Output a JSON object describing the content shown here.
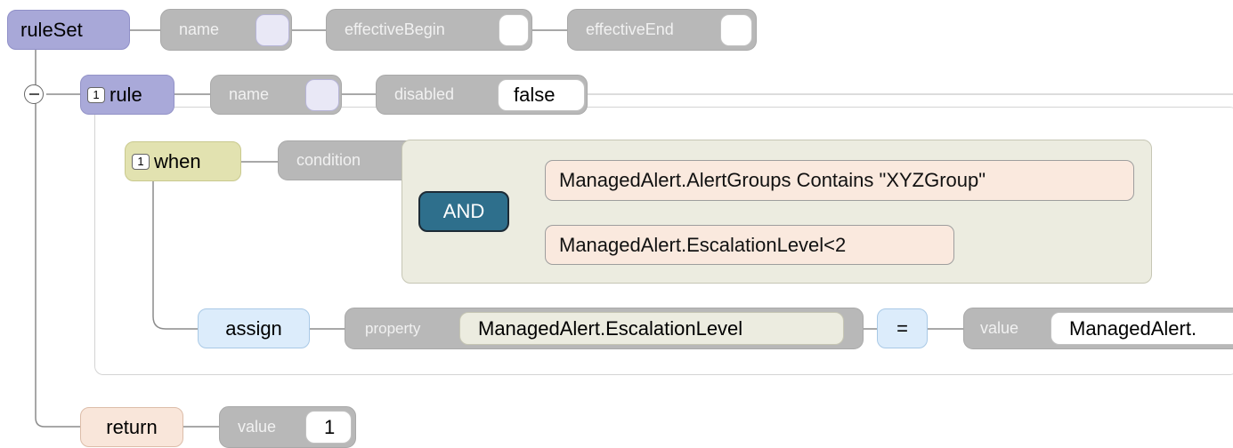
{
  "ruleset": {
    "label": "ruleSet",
    "attributes": [
      {
        "label": "name",
        "value": ""
      },
      {
        "label": "effectiveBegin",
        "value": ""
      },
      {
        "label": "effectiveEnd",
        "value": ""
      }
    ]
  },
  "rule": {
    "badge": "1",
    "label": "rule",
    "attributes": [
      {
        "label": "name",
        "value": ""
      },
      {
        "label": "disabled",
        "value": "false"
      }
    ]
  },
  "when": {
    "badge": "1",
    "label": "when",
    "condition_label": "condition",
    "operator": "AND",
    "expressions": [
      "ManagedAlert.AlertGroups Contains \"XYZGroup\"",
      "ManagedAlert.EscalationLevel<2"
    ]
  },
  "assign": {
    "label": "assign",
    "property_label": "property",
    "property_value": "ManagedAlert.EscalationLevel",
    "operator": "=",
    "value_label": "value",
    "value_value": "ManagedAlert."
  },
  "return": {
    "label": "return",
    "value_label": "value",
    "value_value": "1"
  }
}
